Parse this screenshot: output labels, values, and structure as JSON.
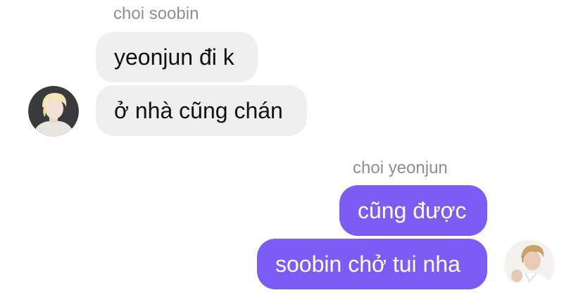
{
  "incoming": {
    "sender": "choi soobin",
    "messages": [
      "yeonjun đi k",
      "ở nhà cũng chán"
    ],
    "avatar_icon": "user-avatar-photo"
  },
  "outgoing": {
    "sender": "choi yeonjun",
    "messages": [
      "cũng được",
      "soobin chở tui nha"
    ],
    "avatar_icon": "user-avatar-photo"
  },
  "colors": {
    "incoming_bubble": "#efefef",
    "outgoing_bubble": "#7b5cf5",
    "sender_name": "#8e8e93"
  }
}
